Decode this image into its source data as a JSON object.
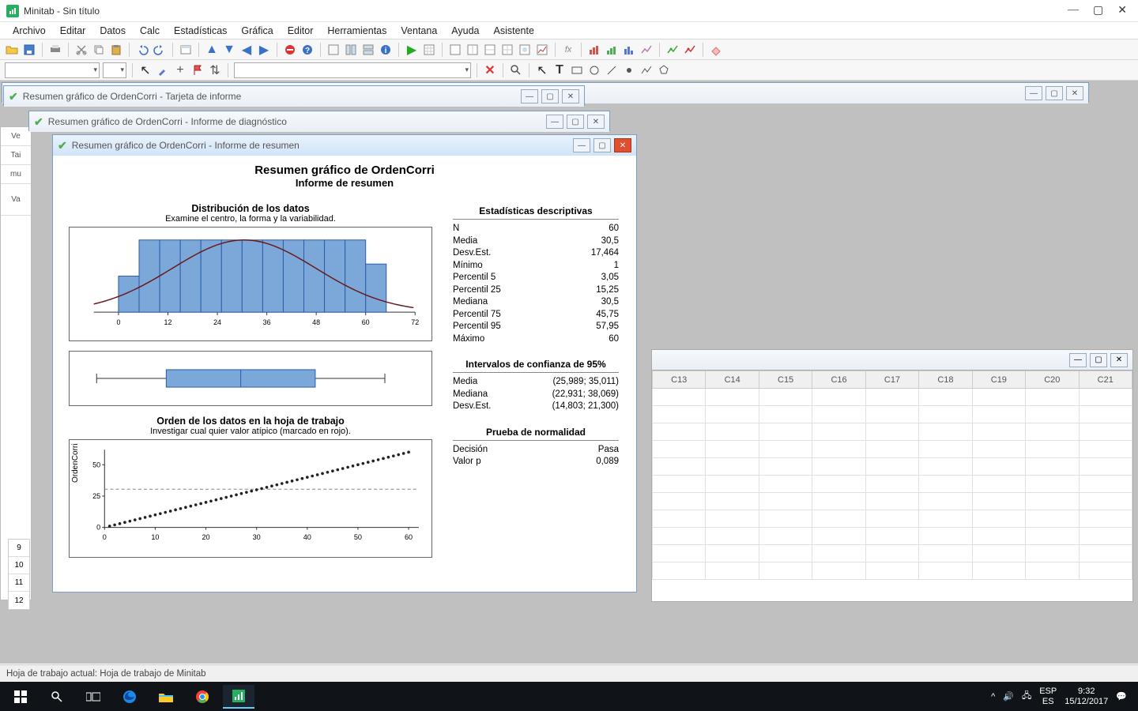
{
  "title": "Minitab - Sin título",
  "menu": [
    "Archivo",
    "Editar",
    "Datos",
    "Calc",
    "Estadísticas",
    "Gráfica",
    "Editor",
    "Herramientas",
    "Ventana",
    "Ayuda",
    "Asistente"
  ],
  "child_windows": {
    "bg1": "Resumen gráfico de OrdenCorri - Tarjeta de informe",
    "bg2": "Resumen gráfico de OrdenCorri - Informe de diagnóstico",
    "active": "Resumen gráfico de OrdenCorri - Informe de resumen"
  },
  "leftstrip": {
    "v": "Ve",
    "t1": "Tai",
    "t2": "mu",
    "v2": "Va",
    "r9": "9",
    "r10": "10",
    "r11": "11",
    "r12": "12"
  },
  "report": {
    "title": "Resumen gráfico de OrdenCorri",
    "subtitle": "Informe de resumen",
    "dist_title": "Distribución de los datos",
    "dist_sub": "Examine el centro, la forma y la variabilidad.",
    "order_title": "Orden de los datos en la hoja de trabajo",
    "order_sub": "Investigar cual quier valor atípico (marcado en rojo).",
    "ylabel": "OrdenCorri"
  },
  "stats": {
    "desc_header": "Estadísticas descriptivas",
    "rows": [
      {
        "k": "N",
        "v": "60"
      },
      {
        "k": "Media",
        "v": "30,5"
      },
      {
        "k": "Desv.Est.",
        "v": "17,464"
      },
      {
        "k": "Mínimo",
        "v": "1"
      },
      {
        "k": "Percentil 5",
        "v": "3,05"
      },
      {
        "k": "Percentil 25",
        "v": "15,25"
      },
      {
        "k": "Mediana",
        "v": "30,5"
      },
      {
        "k": "Percentil 75",
        "v": "45,75"
      },
      {
        "k": "Percentil 95",
        "v": "57,95"
      },
      {
        "k": "Máximo",
        "v": "60"
      }
    ],
    "ci_header": "Intervalos de confianza de 95%",
    "ci_rows": [
      {
        "k": "Media",
        "v": "(25,989; 35,011)"
      },
      {
        "k": "Mediana",
        "v": "(22,931; 38,069)"
      },
      {
        "k": "Desv.Est.",
        "v": "(14,803; 21,300)"
      }
    ],
    "norm_header": "Prueba de normalidad",
    "norm_rows": [
      {
        "k": "Decisión",
        "v": "Pasa"
      },
      {
        "k": "Valor p",
        "v": "0,089"
      }
    ]
  },
  "ws_cols": [
    "C13",
    "C14",
    "C15",
    "C16",
    "C17",
    "C18",
    "C19",
    "C20",
    "C21"
  ],
  "status": "Hoja de trabajo actual: Hoja de trabajo de Minitab",
  "tray": {
    "lang": "ESP",
    "loc": "ES",
    "time": "9:32",
    "date": "15/12/2017"
  },
  "chart_data": [
    {
      "type": "bar",
      "title": "Distribución de los datos",
      "overlay": "normal_curve",
      "x_ticks": [
        0,
        12,
        24,
        36,
        48,
        60,
        72
      ],
      "bin_edges": [
        0,
        5,
        10,
        15,
        20,
        25,
        30,
        35,
        40,
        45,
        50,
        55,
        60,
        65
      ],
      "values": [
        3,
        6,
        6,
        6,
        6,
        6,
        6,
        6,
        6,
        6,
        6,
        6,
        4
      ]
    },
    {
      "type": "boxplot",
      "min": 1,
      "q1": 15.25,
      "median": 30.5,
      "q3": 45.75,
      "max": 60
    },
    {
      "type": "scatter",
      "title": "Orden de los datos en la hoja de trabajo",
      "xlabel": "",
      "ylabel": "OrdenCorri",
      "x_ticks": [
        0,
        10,
        20,
        30,
        40,
        50,
        60
      ],
      "y_ticks": [
        0,
        25,
        50
      ],
      "ref_line_y": 30.5,
      "n": 60,
      "x_range": [
        1,
        60
      ],
      "y_range": [
        1,
        60
      ],
      "pattern": "y = x"
    }
  ]
}
